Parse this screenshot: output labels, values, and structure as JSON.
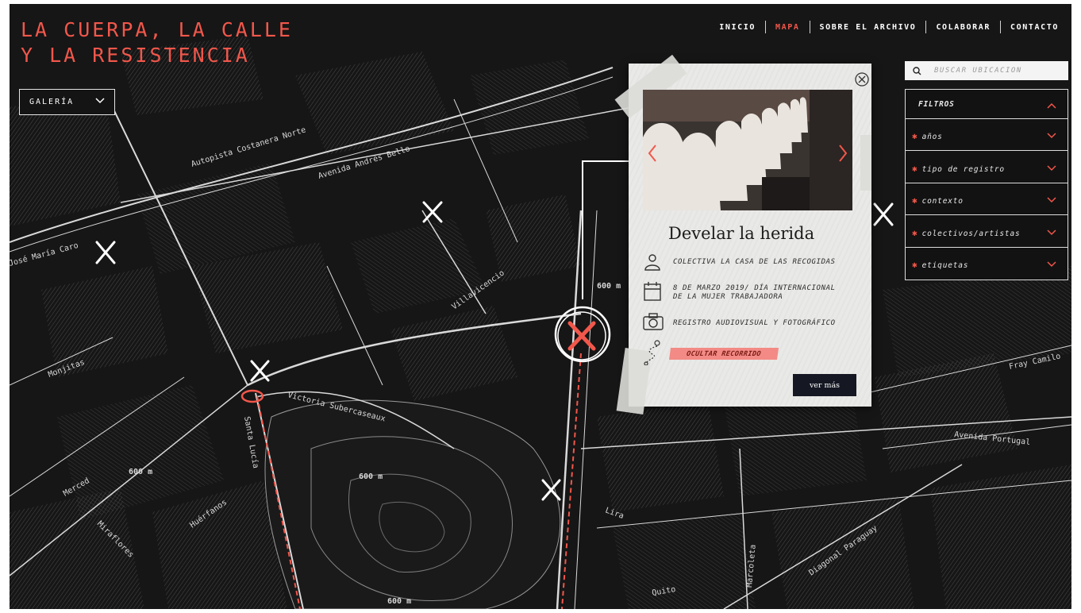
{
  "site": {
    "title_line1": "LA CUERPA, LA CALLE",
    "title_line2": "Y LA RESISTENCIA"
  },
  "nav": {
    "items": [
      {
        "label": "INICIO",
        "active": false
      },
      {
        "label": "MAPA",
        "active": true
      },
      {
        "label": "SOBRE EL ARCHIVO",
        "active": false
      },
      {
        "label": "COLABORAR",
        "active": false
      },
      {
        "label": "CONTACTO",
        "active": false
      }
    ]
  },
  "gallery": {
    "label": "GALERÍA",
    "icon": "chevron-down-icon"
  },
  "search": {
    "placeholder": "BUSCAR UBICACIÓN",
    "icon": "search-icon"
  },
  "filters": {
    "header": "FILTROS",
    "items": [
      {
        "label": "años"
      },
      {
        "label": "tipo de registro"
      },
      {
        "label": "contexto"
      },
      {
        "label": "colectivos/artistas"
      },
      {
        "label": "etiquetas"
      }
    ]
  },
  "card": {
    "title": "Develar la herida",
    "author": "COLECTIVA LA CASA DE LAS RECOGIDAS",
    "date_line1": "8 DE MARZO 2019/ DÍA INTERNACIONAL",
    "date_line2": "DE LA MUJER TRABAJADORA",
    "type": "REGISTRO AUDIOVISUAL Y FOTOGRÁFICO",
    "route_button": "OCULTAR RECORRIDO",
    "more_button": "ver más"
  },
  "map": {
    "streets": [
      "Autopista Costanera Norte",
      "Avenida Andrés Bello",
      "Victoria Subercaseaux",
      "Santa Lucía",
      "Monjitas",
      "Merced",
      "Miraflores",
      "Huérfanos",
      "Avenida Portugal",
      "Diagonal Paraguay",
      "Marcoleta",
      "Quito",
      "José María Caro",
      "Villavicencio",
      "Lira",
      "Fray Camilo"
    ],
    "distance_labels": [
      "600 m",
      "600 m",
      "600 m",
      "600 m"
    ]
  },
  "colors": {
    "accent": "#f2574b",
    "background": "#141414",
    "card": "#e9e9e7"
  }
}
